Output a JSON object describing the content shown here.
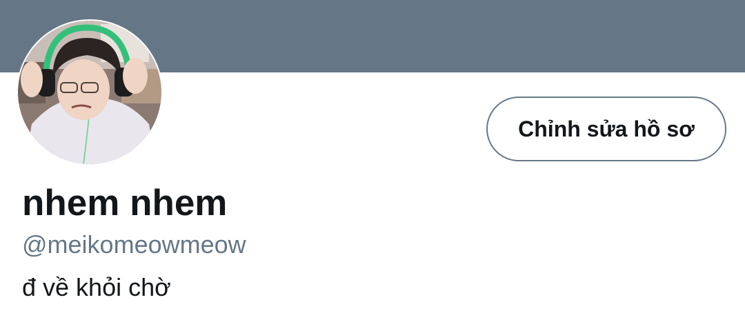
{
  "profile": {
    "display_name": "nhem nhem",
    "handle": "@meikomeowmeow",
    "bio": "đ về khỏi chờ",
    "edit_button_label": "Chỉnh sửa hồ sơ"
  },
  "colors": {
    "banner": "#657786",
    "text_primary": "#14171a",
    "text_secondary": "#657786",
    "button_border": "#657786"
  }
}
